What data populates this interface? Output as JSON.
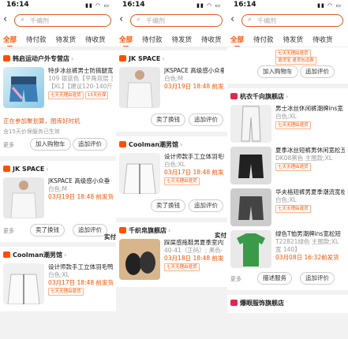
{
  "status": {
    "time": "16:14"
  },
  "search": {
    "placeholder": "千编剂"
  },
  "tabs": [
    "全部",
    "待付款",
    "待发货",
    "待收货"
  ],
  "p1": {
    "shop1": "韩启运动户外专营店",
    "item1": {
      "title": "特步冰丝裤男士防搞腿宽松五",
      "sku": "109 银蓝色【平角双层 宽腰",
      "sku2": "【XL】【建议120-140斤】",
      "tag": "七天无理由退货",
      "tag2": "15天价保"
    },
    "hint": "正在参加聚划算，图库好时机",
    "note": "含15天价保服务已生效",
    "more": "更多",
    "b_cart": "加入购物车",
    "b_review": "追加评价",
    "shop2": "JK SPACE",
    "item2": {
      "title": "JKSPACE 高级感小众垂",
      "sku": "白色;M",
      "date": "03月19日 18:48 前发货"
    },
    "b_exchange": "卖了换钱",
    "shop3": "Coolman潮男馆",
    "item3": {
      "title": "设计师款手工立体羽毛鸭",
      "sku": "白色;XL",
      "date": "03月17日 18:48 前发货",
      "tag": "七天无理由退货"
    }
  },
  "p2": {
    "shop1": "JK SPACE",
    "item1": {
      "title": "JKSPACE 高级感小众垂",
      "sku": "白色;M",
      "date": "03月19日 18:48 前发货"
    },
    "b_exchange": "卖了换钱",
    "b_review": "追加评价",
    "shop2": "Coolman潮男馆",
    "item2": {
      "title": "设计师款手工立体羽毛鸭",
      "sku": "白色;XL",
      "date": "03月17日 18:48 前发货",
      "tag": "七天无理由退货"
    },
    "more": "更多",
    "shop3": "千织帛旗舰店",
    "item3": {
      "title": "踩屎感拖鞋男夏季室内家",
      "sku": "40-41（正码）; 黑色-（",
      "date": "03月18日 18:48 前发货",
      "tag": "七天无理由退货"
    },
    "side": "实付"
  },
  "p3": {
    "top_tag": "七天无理由退货",
    "top_tag2": "退货宝 退货包运费",
    "b_cart": "加入购物车",
    "b_review": "追加评价",
    "shop1": "杭衣千向旗舰店",
    "items": [
      {
        "title": "男士冰丝休闲裤潮牌ins宽",
        "sku": "白色;XL",
        "tag": "七天无理由退货"
      },
      {
        "title": "夏季冰丝短裤男休闲宽松五",
        "sku": "DK08黑色 主图款;XL",
        "tag": "七天无理由退货"
      },
      {
        "title": "华夫格短裤男夏季潮流宽松",
        "sku": "白色;XL",
        "tag": "七天无理由退货"
      },
      {
        "title": "绿色T恤男潮牌ins宽松短",
        "sku": "T22821绿色 主图款;XL",
        "sku2": "宽 140】",
        "date": "03月08日 16:32前发货"
      }
    ],
    "b_more": "更多",
    "b_service": "描述服务",
    "b_review2": "追加评价",
    "side": "实付",
    "shop2": "爆眼服饰旗舰店"
  },
  "colors": {
    "accent": "#ff5000"
  }
}
